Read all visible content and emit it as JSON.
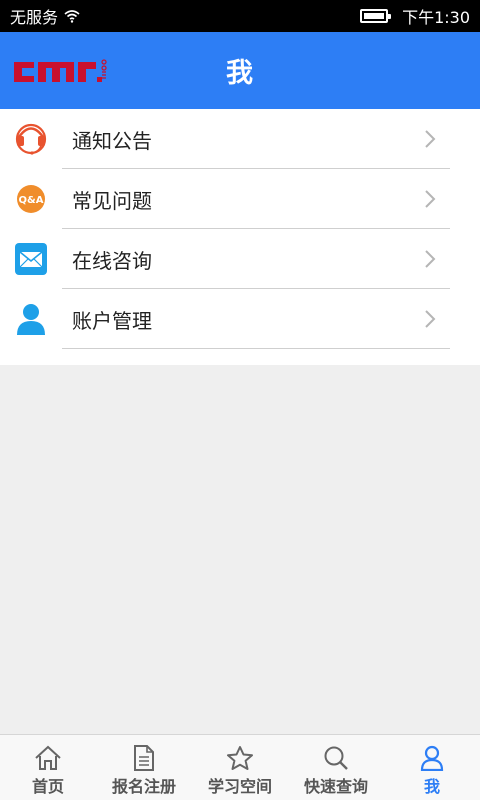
{
  "status_bar": {
    "carrier": "无服务",
    "time": "下午1:30",
    "icons": [
      "wifi-icon",
      "battery-icon"
    ]
  },
  "header": {
    "title": "我",
    "logo_icon": "cmr-logo",
    "colors": {
      "background": "#2d7ef5",
      "logo": "#c8102e"
    }
  },
  "menu": {
    "items": [
      {
        "label": "通知公告",
        "icon": "headset-icon"
      },
      {
        "label": "常见问题",
        "icon": "qa-icon",
        "icon_text": "Q&A"
      },
      {
        "label": "在线咨询",
        "icon": "mail-icon"
      },
      {
        "label": "账户管理",
        "icon": "user-icon"
      }
    ]
  },
  "tab_bar": {
    "active_color": "#2d7ef5",
    "tabs": [
      {
        "label": "首页",
        "icon": "home-icon",
        "active": false
      },
      {
        "label": "报名注册",
        "icon": "document-icon",
        "active": false
      },
      {
        "label": "学习空间",
        "icon": "star-icon",
        "active": false
      },
      {
        "label": "快速查询",
        "icon": "search-icon",
        "active": false
      },
      {
        "label": "我",
        "icon": "person-icon",
        "active": true
      }
    ]
  }
}
